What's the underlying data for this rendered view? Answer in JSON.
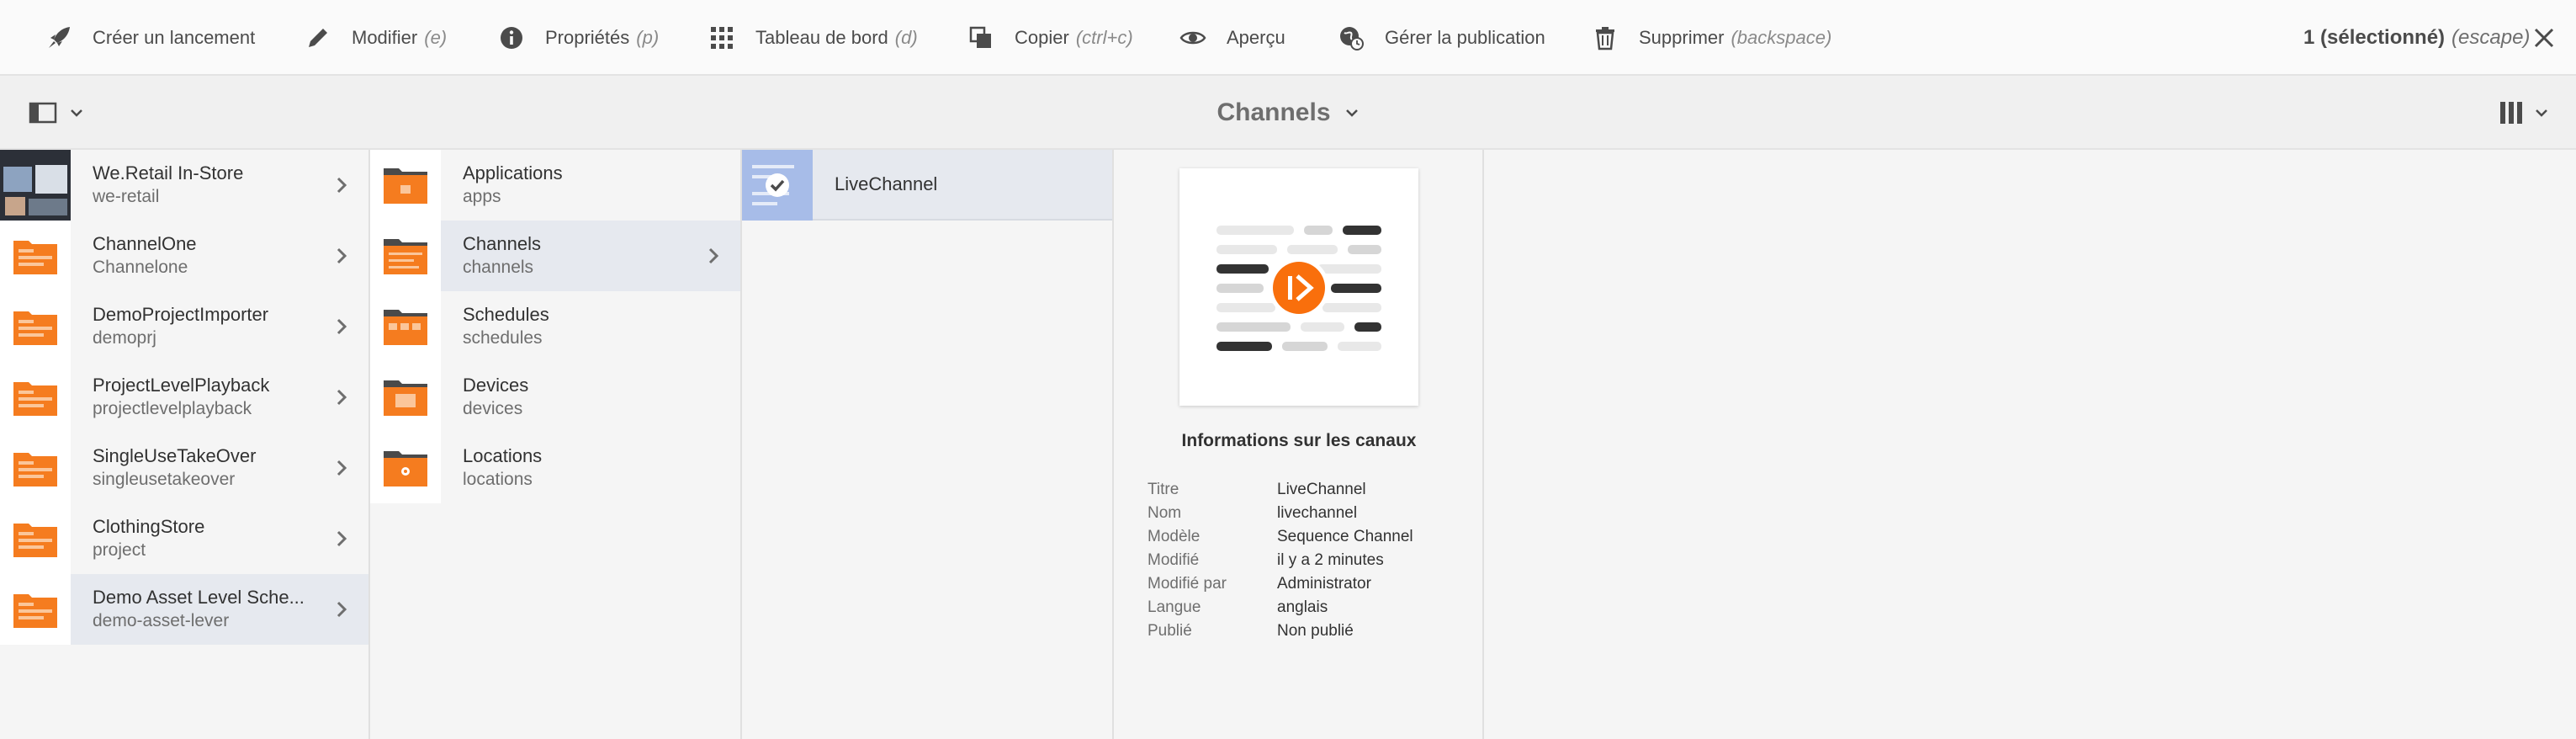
{
  "actionbar": {
    "actions": [
      {
        "label": "Créer un lancement",
        "hint": ""
      },
      {
        "label": "Modifier",
        "hint": "(e)"
      },
      {
        "label": "Propriétés",
        "hint": "(p)"
      },
      {
        "label": "Tableau de bord",
        "hint": "(d)"
      },
      {
        "label": "Copier",
        "hint": "(ctrl+c)"
      },
      {
        "label": "Aperçu",
        "hint": ""
      },
      {
        "label": "Gérer la publication",
        "hint": ""
      },
      {
        "label": "Supprimer",
        "hint": "(backspace)"
      }
    ],
    "selection": {
      "label": "1 (sélectionné)",
      "hint": "(escape)"
    }
  },
  "titlebar": {
    "title": "Channels"
  },
  "column1": [
    {
      "title": "We.Retail In-Store",
      "name": "we-retail"
    },
    {
      "title": "ChannelOne",
      "name": "Channelone"
    },
    {
      "title": "DemoProjectImporter",
      "name": "demoprj"
    },
    {
      "title": "ProjectLevelPlayback",
      "name": "projectlevelplayback"
    },
    {
      "title": "SingleUseTakeOver",
      "name": "singleusetakeover"
    },
    {
      "title": "ClothingStore",
      "name": "project"
    },
    {
      "title": "Demo Asset Level Sche...",
      "name": "demo-asset-lever"
    }
  ],
  "column2": [
    {
      "title": "Applications",
      "name": "apps"
    },
    {
      "title": "Channels",
      "name": "channels"
    },
    {
      "title": "Schedules",
      "name": "schedules"
    },
    {
      "title": "Devices",
      "name": "devices"
    },
    {
      "title": "Locations",
      "name": "locations"
    }
  ],
  "column3": [
    {
      "title": "LiveChannel"
    }
  ],
  "info": {
    "heading": "Informations sur les canaux",
    "properties": [
      {
        "key": "Titre",
        "value": "LiveChannel"
      },
      {
        "key": "Nom",
        "value": "livechannel"
      },
      {
        "key": "Modèle",
        "value": "Sequence Channel"
      },
      {
        "key": "Modifié",
        "value": "il y a 2 minutes"
      },
      {
        "key": "Modifié par",
        "value": "Administrator"
      },
      {
        "key": "Langue",
        "value": "anglais"
      },
      {
        "key": "Publié",
        "value": "Non publié"
      }
    ]
  },
  "colors": {
    "accent_orange": "#f96f0c",
    "folder_orange": "#f57c1f",
    "selected_row": "#e6e9ef",
    "icon": "#4b4b4b"
  }
}
